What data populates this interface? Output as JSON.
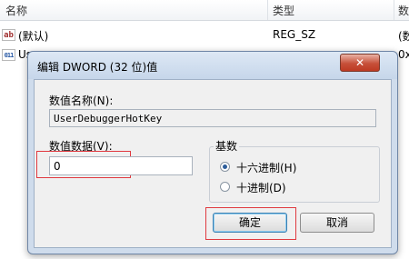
{
  "list": {
    "columns": [
      "名称",
      "类型",
      "数"
    ],
    "rows": [
      {
        "icon": "ab",
        "name": "(默认)",
        "type": "REG_SZ",
        "data": "(数"
      },
      {
        "icon": "011",
        "name": "Us",
        "type": "",
        "data": "0x"
      }
    ]
  },
  "dialog": {
    "title": "编辑 DWORD (32 位)值",
    "close_symbol": "✕",
    "value_name_label": "数值名称(N):",
    "value_name": "UserDebuggerHotKey",
    "value_data_label": "数值数据(V):",
    "value_data": "0",
    "base": {
      "title": "基数",
      "options": [
        {
          "label": "十六进制(H)",
          "selected": true
        },
        {
          "label": "十进制(D)",
          "selected": false
        }
      ]
    },
    "ok_label": "确定",
    "cancel_label": "取消"
  },
  "colors": {
    "highlight": "#e0393f",
    "accent": "#2d5d9a"
  }
}
